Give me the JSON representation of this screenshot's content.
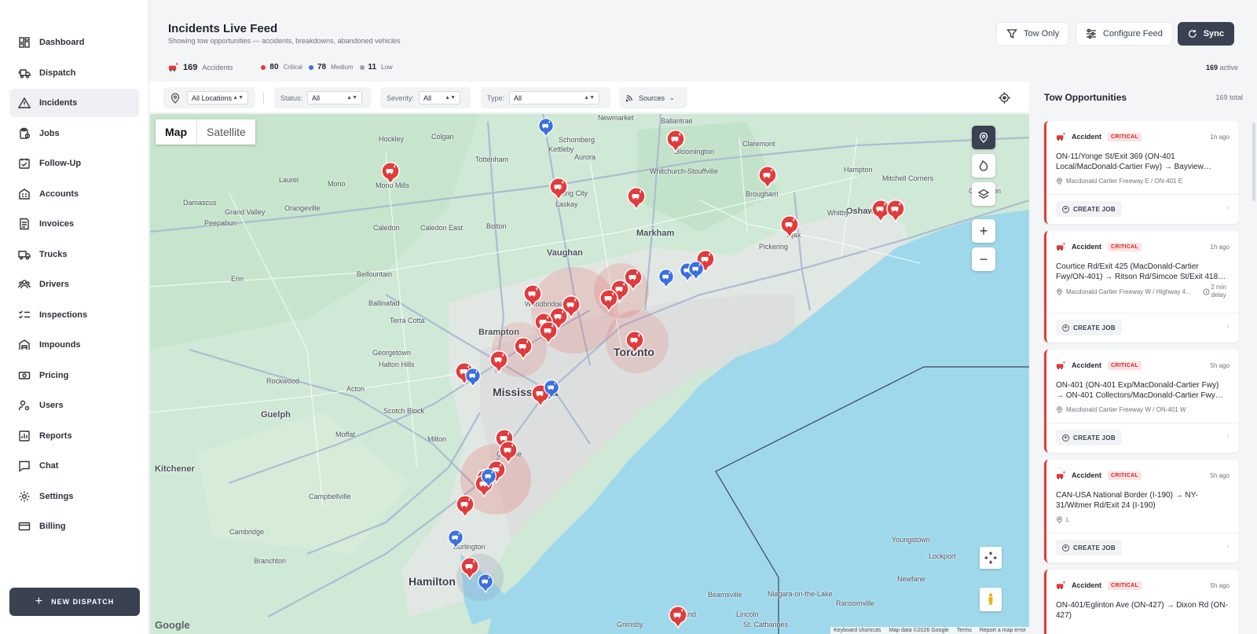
{
  "sidebar": {
    "items": [
      {
        "label": "Dashboard",
        "icon": "dashboard-icon"
      },
      {
        "label": "Dispatch",
        "icon": "truck-fast-icon"
      },
      {
        "label": "Incidents",
        "icon": "warning-icon"
      },
      {
        "label": "Jobs",
        "icon": "clipboard-icon"
      },
      {
        "label": "Follow-Up",
        "icon": "calendar-check-icon"
      },
      {
        "label": "Accounts",
        "icon": "building-icon"
      },
      {
        "label": "Invoices",
        "icon": "invoice-icon"
      },
      {
        "label": "Trucks",
        "icon": "truck-icon"
      },
      {
        "label": "Drivers",
        "icon": "people-icon"
      },
      {
        "label": "Inspections",
        "icon": "checklist-icon"
      },
      {
        "label": "Impounds",
        "icon": "warehouse-icon"
      },
      {
        "label": "Pricing",
        "icon": "money-icon"
      },
      {
        "label": "Users",
        "icon": "user-gear-icon"
      },
      {
        "label": "Reports",
        "icon": "report-icon"
      },
      {
        "label": "Chat",
        "icon": "chat-icon"
      },
      {
        "label": "Settings",
        "icon": "gear-icon"
      },
      {
        "label": "Billing",
        "icon": "credit-card-icon"
      }
    ],
    "active": "Incidents",
    "new_dispatch_label": "NEW DISPATCH"
  },
  "header": {
    "title": "Incidents Live Feed",
    "subtitle": "Showing tow opportunities — accidents, breakdowns, abandoned vehicles",
    "tow_only_label": "Tow Only",
    "configure_label": "Configure Feed",
    "sync_label": "Sync"
  },
  "stats": {
    "total": "169",
    "total_label": "Accidents",
    "critical": "80",
    "critical_label": "Critical",
    "medium": "78",
    "medium_label": "Medium",
    "low": "11",
    "low_label": "Low",
    "active_count": "169",
    "active_label": "active"
  },
  "colors": {
    "critical": "#e23b3b",
    "medium": "#3b6fe2",
    "low": "#9aa3b2",
    "accent": "#3a4151"
  },
  "filters": {
    "location": "All Locations",
    "status_label": "Status:",
    "status_value": "All",
    "severity_label": "Severity:",
    "severity_value": "All",
    "type_label": "Type:",
    "type_value": "All",
    "sources_label": "Sources"
  },
  "map": {
    "map_tab": "Map",
    "satellite_tab": "Satellite",
    "cities": [
      "Toronto",
      "Mississauga",
      "Hamilton",
      "Markham",
      "Vaughan",
      "Brampton",
      "Oshawa",
      "Guelph",
      "Kitchener"
    ],
    "towns": [
      "Hockley",
      "Colgan",
      "Ballantrae",
      "Mono Mills",
      "Laurel",
      "Mono",
      "Tottenham",
      "Schomberg",
      "Kettleby",
      "Newmarket",
      "Aurora",
      "King City",
      "Laskay",
      "Bloomington",
      "Whitchurch-Stouffville",
      "Claremont",
      "Brougham",
      "Hampton",
      "Mitchell Corners",
      "Clarington",
      "Whitby",
      "Pickering",
      "Ajax",
      "Orangeville",
      "Caledon",
      "Caledon East",
      "Bolton",
      "Grand Valley",
      "Peepabun",
      "Damascus",
      "Belfountain",
      "Ballinafad",
      "Terra Cotta",
      "Georgetown",
      "Halton Hills",
      "Woodbridge",
      "Erin",
      "Rockwood",
      "Acton",
      "Milton",
      "Scotch Block",
      "Oakville",
      "Moffat",
      "Campbellville",
      "Cambridge",
      "Branchton",
      "Burlington",
      "Grimsby",
      "Beamsville",
      "Lincoln",
      "Vineland",
      "St. Catharines",
      "Niagara-on-the-Lake",
      "Ransomville",
      "Newfane",
      "Lockport",
      "Youngstown"
    ],
    "keyboard_shortcuts": "Keyboard shortcuts",
    "map_data": "Map data ©2026 Google",
    "terms": "Terms",
    "report": "Report a map error",
    "logo": "Google"
  },
  "panel": {
    "title": "Tow Opportunities",
    "count": "169 total",
    "create_job_label": "CREATE JOB",
    "cards": [
      {
        "type": "Accident",
        "severity": "CRITICAL",
        "time": "1h ago",
        "title": "ON-11/Yonge St/Exit 369 (ON-401 Local/MacDonald-Cartier Fwy) → Bayview…",
        "location": "Macdonald Cartier Freeway E / ON-401 E",
        "delay": ""
      },
      {
        "type": "Accident",
        "severity": "CRITICAL",
        "time": "1h ago",
        "title": "Courtice Rd/Exit 425 (MacDonald-Cartier Fwy/ON-401) → Ritson Rd/Simcoe St/Exit 418…",
        "location": "Macdonald Cartier Freeway W / Highway 4…",
        "delay": "2 min delay"
      },
      {
        "type": "Accident",
        "severity": "CRITICAL",
        "time": "5h ago",
        "title": "ON-401 (ON-401 Exp/MacDonald-Cartier Fwy) → ON-401 Collectors/MacDonald-Cartier Fwy…",
        "location": "Macdonald Cartier Freeway W / ON-401 W",
        "delay": ""
      },
      {
        "type": "Accident",
        "severity": "CRITICAL",
        "time": "5h ago",
        "title": "CAN-USA National Border (I-190) → NY-31/Witmer Rd/Exit 24 (I-190)",
        "location": "L",
        "delay": ""
      },
      {
        "type": "Accident",
        "severity": "CRITICAL",
        "time": "5h ago",
        "title": "ON-401/Eglinton Ave (ON-427) → Dixon Rd (ON-427)",
        "location": "",
        "delay": ""
      }
    ]
  }
}
